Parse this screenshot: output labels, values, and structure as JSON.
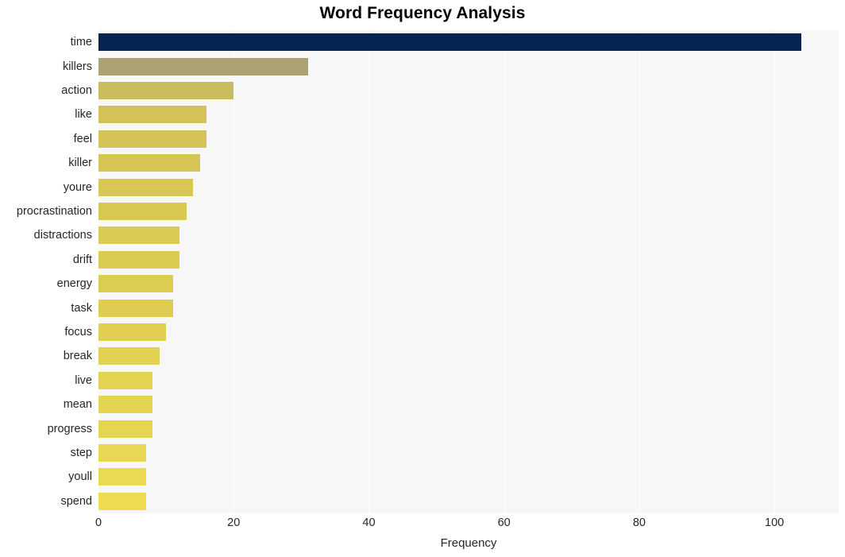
{
  "chart_data": {
    "type": "bar",
    "orientation": "horizontal",
    "title": "Word Frequency Analysis",
    "xlabel": "Frequency",
    "ylabel": "",
    "categories": [
      "time",
      "killers",
      "action",
      "like",
      "feel",
      "killer",
      "youre",
      "procrastination",
      "distractions",
      "drift",
      "energy",
      "task",
      "focus",
      "break",
      "live",
      "mean",
      "progress",
      "step",
      "youll",
      "spend"
    ],
    "values": [
      104,
      31,
      20,
      16,
      16,
      15,
      14,
      13,
      12,
      12,
      11,
      11,
      10,
      9,
      8,
      8,
      8,
      7,
      7,
      7
    ],
    "bar_colors": [
      "#03254f",
      "#aba272",
      "#c9bc5e",
      "#d3c257",
      "#d4c356",
      "#d6c555",
      "#d8c754",
      "#d9c854",
      "#dbca53",
      "#dccb53",
      "#ddcc52",
      "#decd52",
      "#e0cf52",
      "#e2d152",
      "#e4d352",
      "#e5d452",
      "#e6d552",
      "#e8d752",
      "#ebd952",
      "#eedb52"
    ],
    "xlim": [
      0,
      109.5
    ],
    "xticks": [
      0,
      20,
      40,
      60,
      80,
      100
    ],
    "xticklabels": [
      "0",
      "20",
      "40",
      "60",
      "80",
      "100"
    ],
    "grid": true,
    "grid_axis": "x",
    "grid_color": "#ffffff",
    "plot_background": "#f7f7f7",
    "figure_background": "#ffffff",
    "legend": null
  }
}
